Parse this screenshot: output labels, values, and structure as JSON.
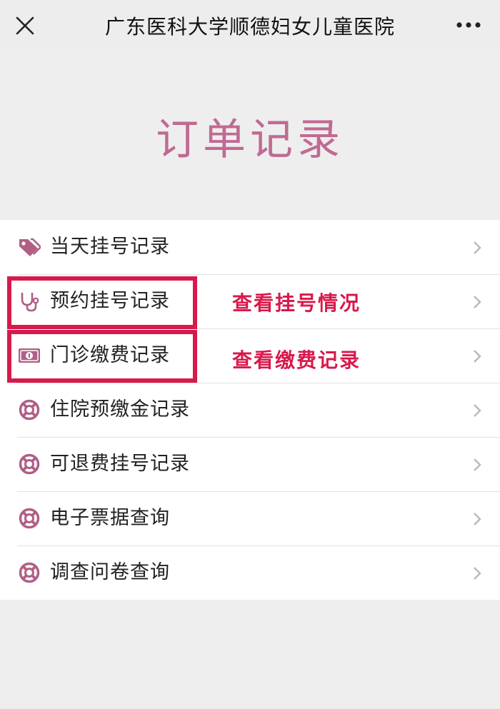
{
  "topbar": {
    "title": "广东医科大学顺德妇女儿童医院"
  },
  "page_heading": "订单记录",
  "menu": [
    {
      "label": "当天挂号记录",
      "icon": "tag-icon"
    },
    {
      "label": "预约挂号记录",
      "icon": "stethoscope-icon"
    },
    {
      "label": "门诊缴费记录",
      "icon": "money-icon"
    },
    {
      "label": "住院预缴金记录",
      "icon": "lifebuoy-icon"
    },
    {
      "label": "可退费挂号记录",
      "icon": "lifebuoy-icon"
    },
    {
      "label": "电子票据查询",
      "icon": "lifebuoy-icon"
    },
    {
      "label": "调查问卷查询",
      "icon": "lifebuoy-icon"
    }
  ],
  "annotations": {
    "registration": "查看挂号情况",
    "payment": "查看缴费记录"
  },
  "colors": {
    "accent": "#c06a93",
    "annotation": "#d8194b",
    "icon": "#b05f86",
    "chevron": "#b9b9b9"
  }
}
